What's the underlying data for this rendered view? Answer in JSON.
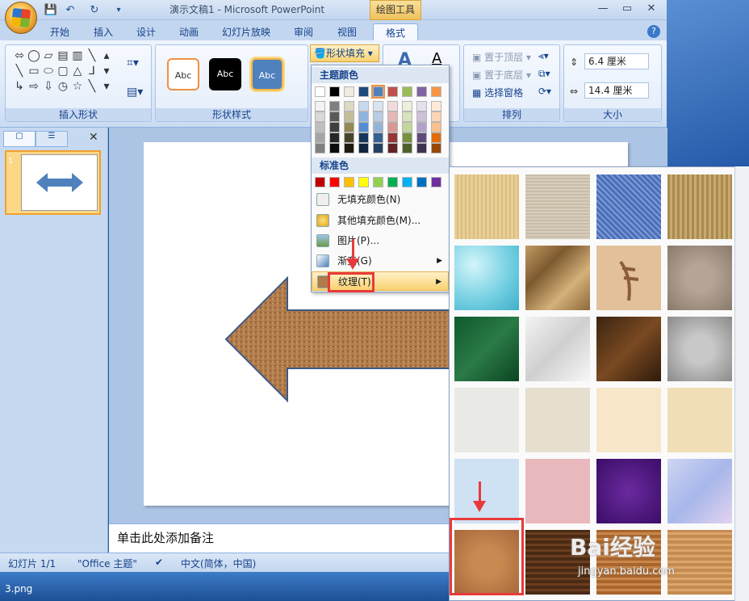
{
  "window": {
    "title": "演示文稿1 - Microsoft PowerPoint",
    "context_tab": "绘图工具"
  },
  "tabs": [
    "开始",
    "插入",
    "设计",
    "动画",
    "幻灯片放映",
    "审阅",
    "视图",
    "格式"
  ],
  "ribbon": {
    "groups": {
      "insert_shapes": "插入形状",
      "shape_styles": "形状样式",
      "arrange": "排列",
      "size": "大小"
    },
    "style_label": "Abc",
    "fill_button": "形状填充",
    "arrange": {
      "bring_front": "置于顶层",
      "send_back": "置于底层",
      "selection_pane": "选择窗格"
    },
    "size": {
      "height": "6.4 厘米",
      "width": "14.4 厘米"
    }
  },
  "fill_menu": {
    "theme_colors_label": "主题颜色",
    "standard_colors_label": "标准色",
    "items": {
      "no_fill": "无填充颜色(N)",
      "more_colors": "其他填充颜色(M)...",
      "picture": "图片(P)...",
      "gradient": "渐变(G)",
      "texture": "纹理(T)"
    }
  },
  "notes_placeholder": "单击此处添加备注",
  "status": {
    "slide": "幻灯片 1/1",
    "theme": "\"Office 主题\"",
    "language": "中文(简体，中国)"
  },
  "file_label": "3.png",
  "watermark": {
    "brand": "Bai经验",
    "url": "jingyan.baidu.com"
  },
  "colors": {
    "accent_red": "#e83a3a",
    "ribbon_blue": "#15428b",
    "arrow_fill": "#b07a4a",
    "arrow_stroke": "#3d5a86"
  }
}
